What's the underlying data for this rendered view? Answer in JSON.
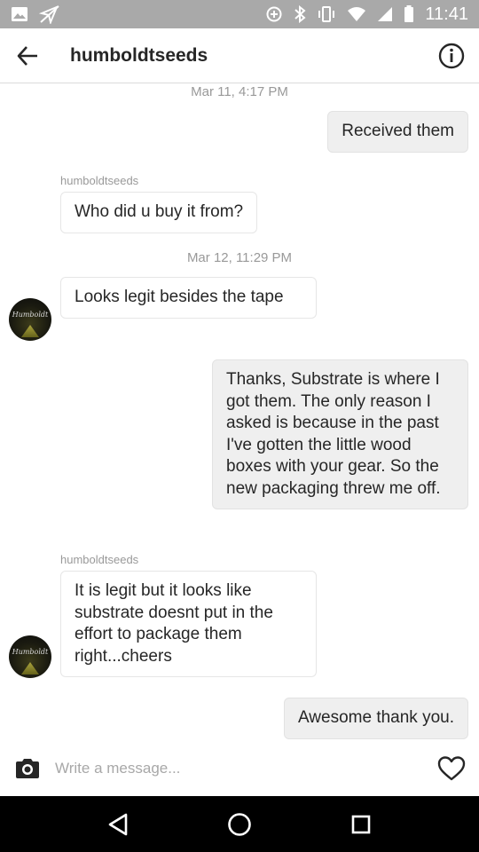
{
  "status_bar": {
    "time": "11:41",
    "left_icons": [
      "image-icon",
      "no-location-icon"
    ],
    "right_icons": [
      "data-saver-icon",
      "bluetooth-icon",
      "vibrate-icon",
      "wifi-icon",
      "cell-signal-icon",
      "battery-icon"
    ]
  },
  "header": {
    "title": "humboldtseeds",
    "back_icon": "arrow-left-icon",
    "info_icon": "info-icon"
  },
  "messages": [
    {
      "type": "timestamp",
      "text": "Mar 11, 4:17 PM"
    },
    {
      "type": "outgoing",
      "text": "Received them"
    },
    {
      "type": "sender",
      "text": "humboldtseeds"
    },
    {
      "type": "incoming",
      "text": "Who did u buy it from?"
    },
    {
      "type": "timestamp",
      "text": "Mar 12, 11:29 PM"
    },
    {
      "type": "incoming",
      "text": "Looks legit besides the tape"
    },
    {
      "type": "outgoing",
      "text": "Thanks, Substrate is where I got them. The only reason I asked is because in the past I've gotten the little wood boxes with your gear. So the new packaging threw me off."
    },
    {
      "type": "sender",
      "text": "humboldtseeds"
    },
    {
      "type": "incoming",
      "text": "It is legit but it looks like substrate doesnt put in the effort to package them right...cheers"
    },
    {
      "type": "outgoing",
      "text": "Awesome thank you."
    }
  ],
  "avatar": {
    "logo_text": "Humboldt"
  },
  "composer": {
    "placeholder": "Write a message...",
    "camera_icon": "camera-icon",
    "like_icon": "heart-icon"
  },
  "nav_bar": {
    "icons": [
      "back-triangle-icon",
      "home-circle-icon",
      "recents-square-icon"
    ]
  },
  "colors": {
    "status_bar": "#a9a9a9",
    "outgoing_bubble": "#efefef",
    "incoming_bubble": "#ffffff",
    "meta_text": "#999999",
    "nav_bar": "#000000"
  }
}
